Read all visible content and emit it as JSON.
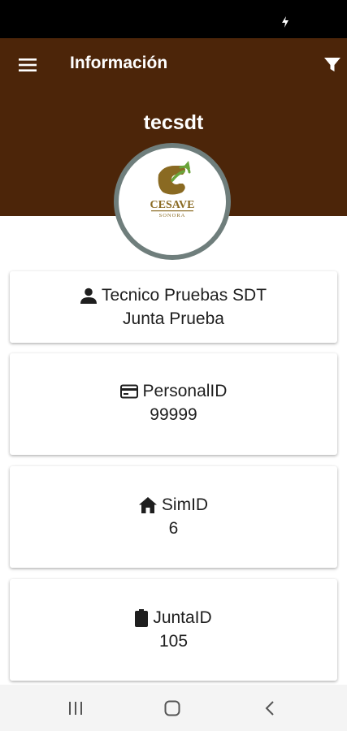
{
  "app_bar": {
    "title": "Información",
    "menu_icon": "hamburger-menu-icon",
    "filter_icon": "filter-funnel-icon",
    "color": "#4c2509"
  },
  "profile": {
    "username": "tecsdt",
    "logo": {
      "name": "CESAVE",
      "subtitle": "SONORA",
      "ring_color": "#6f7e7c",
      "brand_color": "#8a6a22"
    }
  },
  "cards": [
    {
      "icon": "person-icon",
      "line1": "Tecnico Pruebas SDT",
      "line2": "Junta Prueba"
    },
    {
      "icon": "id-card-icon",
      "line1": "PersonalID",
      "line2": "99999"
    },
    {
      "icon": "home-icon",
      "line1": "SimID",
      "line2": "6"
    },
    {
      "icon": "clipboard-icon",
      "line1": "JuntaID",
      "line2": "105"
    }
  ],
  "system_nav": {
    "recents_icon": "recents-icon",
    "home_icon": "home-circle-icon",
    "back_icon": "back-chevron-icon"
  }
}
